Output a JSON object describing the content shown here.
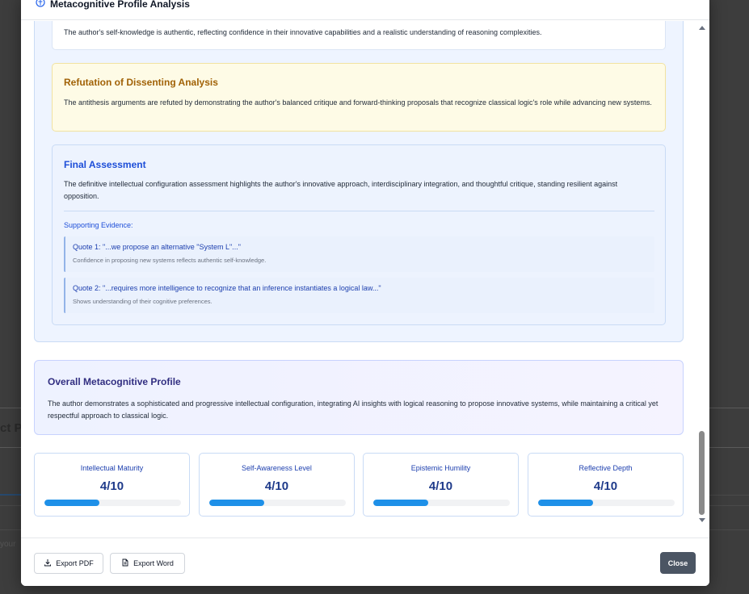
{
  "background": {
    "partial_text_1": "ct Pr",
    "partial_text_2": "your"
  },
  "modal": {
    "title": "Metacognitive Profile Analysis",
    "title_icon": "brain-icon"
  },
  "self_knowledge": {
    "text": "The author's self-knowledge is authentic, reflecting confidence in their innovative capabilities and a realistic understanding of reasoning complexities."
  },
  "refutation": {
    "title": "Refutation of Dissenting Analysis",
    "text": "The antithesis arguments are refuted by demonstrating the author's balanced critique and forward-thinking proposals that recognize classical logic's role while advancing new systems."
  },
  "final_assessment": {
    "title": "Final Assessment",
    "text": "The definitive intellectual configuration assessment highlights the author's innovative approach, interdisciplinary integration, and thoughtful critique, standing resilient against opposition.",
    "evidence_label": "Supporting Evidence:",
    "quotes": [
      {
        "title": "Quote 1: \"...we propose an alternative \"System L\"...\"",
        "note": "Confidence in proposing new systems reflects authentic self-knowledge."
      },
      {
        "title": "Quote 2: \"...requires more intelligence to recognize that an inference instantiates a logical law...\"",
        "note": "Shows understanding of their cognitive preferences."
      }
    ]
  },
  "overall": {
    "title": "Overall Metacognitive Profile",
    "text": "The author demonstrates a sophisticated and progressive intellectual configuration, integrating AI insights with logical reasoning to propose innovative systems, while maintaining a critical yet respectful approach to classical logic."
  },
  "metrics": [
    {
      "label": "Intellectual Maturity",
      "value": "4/10",
      "fraction": 0.4
    },
    {
      "label": "Self-Awareness Level",
      "value": "4/10",
      "fraction": 0.4
    },
    {
      "label": "Epistemic Humility",
      "value": "4/10",
      "fraction": 0.4
    },
    {
      "label": "Reflective Depth",
      "value": "4/10",
      "fraction": 0.4
    }
  ],
  "footer": {
    "export_pdf": "Export PDF",
    "export_word": "Export Word",
    "close": "Close"
  },
  "colors": {
    "accent": "#1e90e8",
    "refute_heading": "#a16207",
    "final_heading": "#1d4ed8",
    "close_button": "#4b5563"
  }
}
